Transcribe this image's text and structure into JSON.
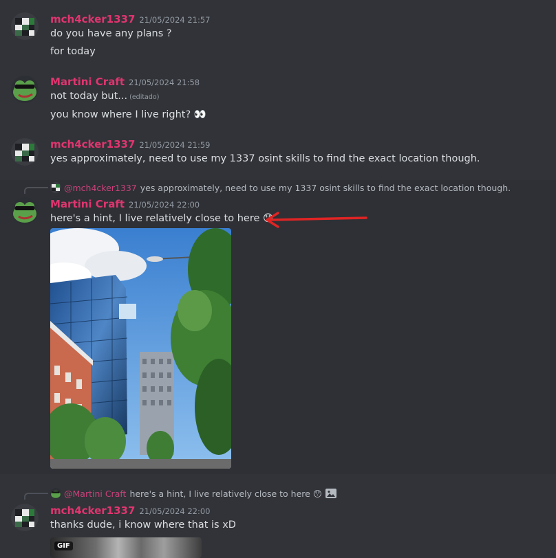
{
  "messages": [
    {
      "author": "mch4cker1337",
      "timestamp": "21/05/2024 21:57",
      "lines": [
        "do you have any plans ?",
        "for today"
      ]
    },
    {
      "author": "Martini Craft",
      "timestamp": "21/05/2024 21:58",
      "lines": [
        "not today but...",
        "you know where I live right? 👀"
      ],
      "edited": "(editado)"
    },
    {
      "author": "mch4cker1337",
      "timestamp": "21/05/2024 21:59",
      "lines": [
        "yes approximately, need to use my 1337 osint skills to find the exact location though."
      ]
    },
    {
      "reply_mention": "@mch4cker1337",
      "reply_text": "yes approximately, need to use my 1337 osint skills to find the exact location though.",
      "author": "Martini Craft",
      "timestamp": "21/05/2024 22:00",
      "lines": [
        "here's a hint, I live relatively close to here 😯"
      ]
    },
    {
      "reply_mention": "@Martini Craft",
      "reply_text": "here's a hint, I live relatively close to here 😯",
      "author": "mch4cker1337",
      "timestamp": "21/05/2024 22:00",
      "lines": [
        "thanks dude, i know where that is xD"
      ],
      "gif_label": "GIF"
    }
  ],
  "colors": {
    "background": "#313338",
    "username": "#e0356f",
    "timestamp": "#949ba4",
    "text": "#dbdee1",
    "arrow": "#e02424"
  }
}
